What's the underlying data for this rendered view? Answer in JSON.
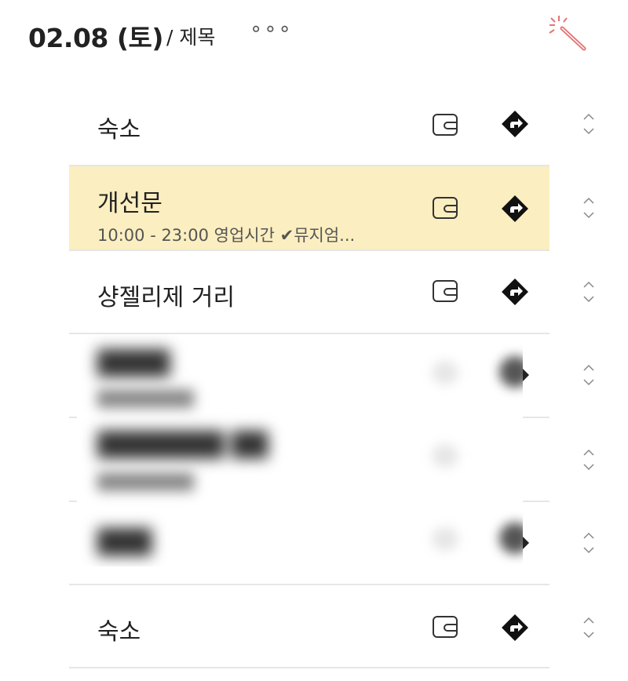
{
  "header": {
    "date": "02.08 (토)",
    "title": "/ 제목",
    "more": "∘∘∘"
  },
  "items": [
    {
      "name": "숙소",
      "sub": ""
    },
    {
      "name": "개선문",
      "sub": "10:00 - 23:00 영업시간 ✔뮤지엄..."
    },
    {
      "name": "샹젤리제 거리",
      "sub": ""
    },
    {
      "name": "숙소",
      "sub": ""
    }
  ],
  "icons": {
    "wand": "magic-wand-icon",
    "wallet": "wallet-icon",
    "nav": "directions-icon",
    "sort": "sort-handle-icon"
  },
  "colors": {
    "highlight": "#fbeec0",
    "wand_accent": "#e57373"
  }
}
